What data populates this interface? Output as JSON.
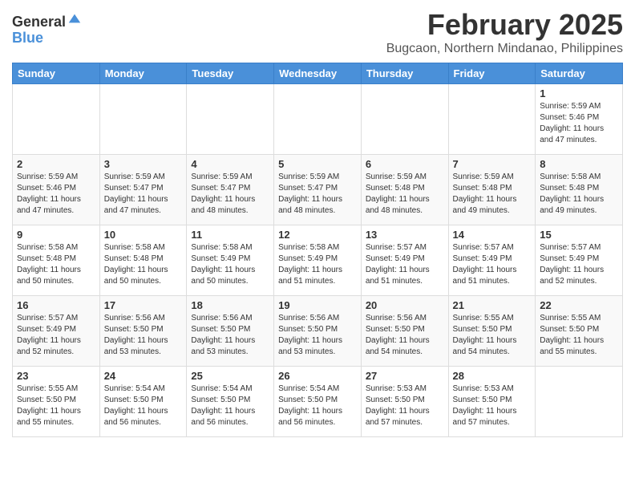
{
  "header": {
    "logo_general": "General",
    "logo_blue": "Blue",
    "month_title": "February 2025",
    "location": "Bugcaon, Northern Mindanao, Philippines"
  },
  "weekdays": [
    "Sunday",
    "Monday",
    "Tuesday",
    "Wednesday",
    "Thursday",
    "Friday",
    "Saturday"
  ],
  "weeks": [
    [
      {
        "day": "",
        "info": ""
      },
      {
        "day": "",
        "info": ""
      },
      {
        "day": "",
        "info": ""
      },
      {
        "day": "",
        "info": ""
      },
      {
        "day": "",
        "info": ""
      },
      {
        "day": "",
        "info": ""
      },
      {
        "day": "1",
        "info": "Sunrise: 5:59 AM\nSunset: 5:46 PM\nDaylight: 11 hours\nand 47 minutes."
      }
    ],
    [
      {
        "day": "2",
        "info": "Sunrise: 5:59 AM\nSunset: 5:46 PM\nDaylight: 11 hours\nand 47 minutes."
      },
      {
        "day": "3",
        "info": "Sunrise: 5:59 AM\nSunset: 5:47 PM\nDaylight: 11 hours\nand 47 minutes."
      },
      {
        "day": "4",
        "info": "Sunrise: 5:59 AM\nSunset: 5:47 PM\nDaylight: 11 hours\nand 48 minutes."
      },
      {
        "day": "5",
        "info": "Sunrise: 5:59 AM\nSunset: 5:47 PM\nDaylight: 11 hours\nand 48 minutes."
      },
      {
        "day": "6",
        "info": "Sunrise: 5:59 AM\nSunset: 5:48 PM\nDaylight: 11 hours\nand 48 minutes."
      },
      {
        "day": "7",
        "info": "Sunrise: 5:59 AM\nSunset: 5:48 PM\nDaylight: 11 hours\nand 49 minutes."
      },
      {
        "day": "8",
        "info": "Sunrise: 5:58 AM\nSunset: 5:48 PM\nDaylight: 11 hours\nand 49 minutes."
      }
    ],
    [
      {
        "day": "9",
        "info": "Sunrise: 5:58 AM\nSunset: 5:48 PM\nDaylight: 11 hours\nand 50 minutes."
      },
      {
        "day": "10",
        "info": "Sunrise: 5:58 AM\nSunset: 5:48 PM\nDaylight: 11 hours\nand 50 minutes."
      },
      {
        "day": "11",
        "info": "Sunrise: 5:58 AM\nSunset: 5:49 PM\nDaylight: 11 hours\nand 50 minutes."
      },
      {
        "day": "12",
        "info": "Sunrise: 5:58 AM\nSunset: 5:49 PM\nDaylight: 11 hours\nand 51 minutes."
      },
      {
        "day": "13",
        "info": "Sunrise: 5:57 AM\nSunset: 5:49 PM\nDaylight: 11 hours\nand 51 minutes."
      },
      {
        "day": "14",
        "info": "Sunrise: 5:57 AM\nSunset: 5:49 PM\nDaylight: 11 hours\nand 51 minutes."
      },
      {
        "day": "15",
        "info": "Sunrise: 5:57 AM\nSunset: 5:49 PM\nDaylight: 11 hours\nand 52 minutes."
      }
    ],
    [
      {
        "day": "16",
        "info": "Sunrise: 5:57 AM\nSunset: 5:49 PM\nDaylight: 11 hours\nand 52 minutes."
      },
      {
        "day": "17",
        "info": "Sunrise: 5:56 AM\nSunset: 5:50 PM\nDaylight: 11 hours\nand 53 minutes."
      },
      {
        "day": "18",
        "info": "Sunrise: 5:56 AM\nSunset: 5:50 PM\nDaylight: 11 hours\nand 53 minutes."
      },
      {
        "day": "19",
        "info": "Sunrise: 5:56 AM\nSunset: 5:50 PM\nDaylight: 11 hours\nand 53 minutes."
      },
      {
        "day": "20",
        "info": "Sunrise: 5:56 AM\nSunset: 5:50 PM\nDaylight: 11 hours\nand 54 minutes."
      },
      {
        "day": "21",
        "info": "Sunrise: 5:55 AM\nSunset: 5:50 PM\nDaylight: 11 hours\nand 54 minutes."
      },
      {
        "day": "22",
        "info": "Sunrise: 5:55 AM\nSunset: 5:50 PM\nDaylight: 11 hours\nand 55 minutes."
      }
    ],
    [
      {
        "day": "23",
        "info": "Sunrise: 5:55 AM\nSunset: 5:50 PM\nDaylight: 11 hours\nand 55 minutes."
      },
      {
        "day": "24",
        "info": "Sunrise: 5:54 AM\nSunset: 5:50 PM\nDaylight: 11 hours\nand 56 minutes."
      },
      {
        "day": "25",
        "info": "Sunrise: 5:54 AM\nSunset: 5:50 PM\nDaylight: 11 hours\nand 56 minutes."
      },
      {
        "day": "26",
        "info": "Sunrise: 5:54 AM\nSunset: 5:50 PM\nDaylight: 11 hours\nand 56 minutes."
      },
      {
        "day": "27",
        "info": "Sunrise: 5:53 AM\nSunset: 5:50 PM\nDaylight: 11 hours\nand 57 minutes."
      },
      {
        "day": "28",
        "info": "Sunrise: 5:53 AM\nSunset: 5:50 PM\nDaylight: 11 hours\nand 57 minutes."
      },
      {
        "day": "",
        "info": ""
      }
    ]
  ]
}
